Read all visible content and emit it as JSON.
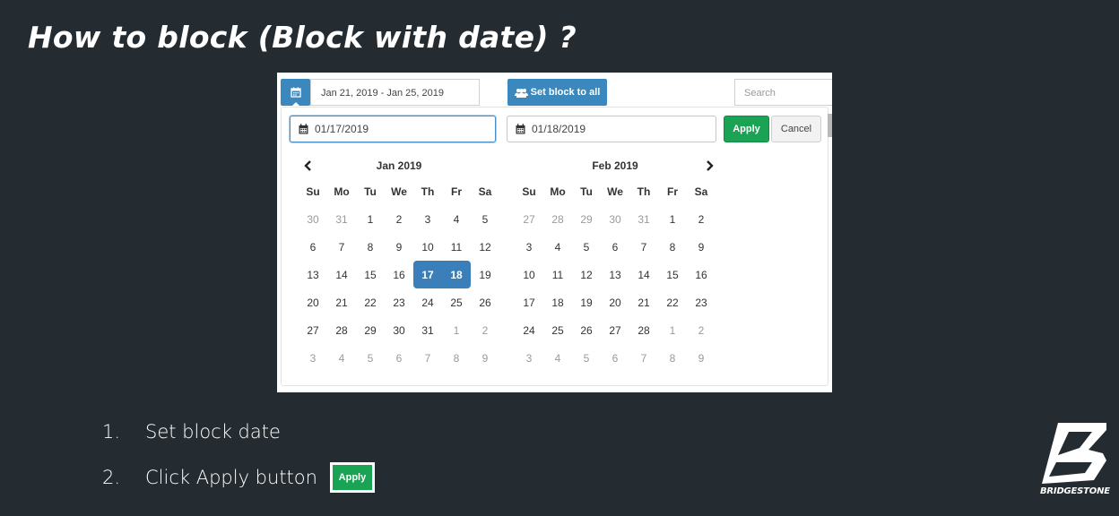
{
  "slide": {
    "title": "How to block (Block with date) ?"
  },
  "toolbar": {
    "range_value": "Jan 21, 2019 - Jan 25, 2019",
    "set_all_label": "Set block to all",
    "search_placeholder": "Search"
  },
  "picker": {
    "start_date": "01/17/2019",
    "end_date": "01/18/2019",
    "apply_label": "Apply",
    "cancel_label": "Cancel",
    "weekdays": [
      "Su",
      "Mo",
      "Tu",
      "We",
      "Th",
      "Fr",
      "Sa"
    ],
    "months": [
      {
        "name": "Jan 2019",
        "weeks": [
          [
            {
              "d": "30",
              "off": true
            },
            {
              "d": "31",
              "off": true
            },
            {
              "d": "1"
            },
            {
              "d": "2"
            },
            {
              "d": "3"
            },
            {
              "d": "4"
            },
            {
              "d": "5"
            }
          ],
          [
            {
              "d": "6"
            },
            {
              "d": "7"
            },
            {
              "d": "8"
            },
            {
              "d": "9"
            },
            {
              "d": "10"
            },
            {
              "d": "11"
            },
            {
              "d": "12"
            }
          ],
          [
            {
              "d": "13"
            },
            {
              "d": "14"
            },
            {
              "d": "15"
            },
            {
              "d": "16"
            },
            {
              "d": "17",
              "sel": "start"
            },
            {
              "d": "18",
              "sel": "end"
            },
            {
              "d": "19"
            }
          ],
          [
            {
              "d": "20"
            },
            {
              "d": "21"
            },
            {
              "d": "22"
            },
            {
              "d": "23"
            },
            {
              "d": "24"
            },
            {
              "d": "25"
            },
            {
              "d": "26"
            }
          ],
          [
            {
              "d": "27"
            },
            {
              "d": "28"
            },
            {
              "d": "29"
            },
            {
              "d": "30"
            },
            {
              "d": "31"
            },
            {
              "d": "1",
              "off": true
            },
            {
              "d": "2",
              "off": true
            }
          ],
          [
            {
              "d": "3",
              "off": true
            },
            {
              "d": "4",
              "off": true
            },
            {
              "d": "5",
              "off": true
            },
            {
              "d": "6",
              "off": true
            },
            {
              "d": "7",
              "off": true
            },
            {
              "d": "8",
              "off": true
            },
            {
              "d": "9",
              "off": true
            }
          ]
        ]
      },
      {
        "name": "Feb 2019",
        "weeks": [
          [
            {
              "d": "27",
              "off": true
            },
            {
              "d": "28",
              "off": true
            },
            {
              "d": "29",
              "off": true
            },
            {
              "d": "30",
              "off": true
            },
            {
              "d": "31",
              "off": true
            },
            {
              "d": "1"
            },
            {
              "d": "2"
            }
          ],
          [
            {
              "d": "3"
            },
            {
              "d": "4"
            },
            {
              "d": "5"
            },
            {
              "d": "6"
            },
            {
              "d": "7"
            },
            {
              "d": "8"
            },
            {
              "d": "9"
            }
          ],
          [
            {
              "d": "10"
            },
            {
              "d": "11"
            },
            {
              "d": "12"
            },
            {
              "d": "13"
            },
            {
              "d": "14"
            },
            {
              "d": "15"
            },
            {
              "d": "16"
            }
          ],
          [
            {
              "d": "17"
            },
            {
              "d": "18"
            },
            {
              "d": "19"
            },
            {
              "d": "20"
            },
            {
              "d": "21"
            },
            {
              "d": "22"
            },
            {
              "d": "23"
            }
          ],
          [
            {
              "d": "24"
            },
            {
              "d": "25"
            },
            {
              "d": "26"
            },
            {
              "d": "27"
            },
            {
              "d": "28"
            },
            {
              "d": "1",
              "off": true
            },
            {
              "d": "2",
              "off": true
            }
          ],
          [
            {
              "d": "3",
              "off": true
            },
            {
              "d": "4",
              "off": true
            },
            {
              "d": "5",
              "off": true
            },
            {
              "d": "6",
              "off": true
            },
            {
              "d": "7",
              "off": true
            },
            {
              "d": "8",
              "off": true
            },
            {
              "d": "9",
              "off": true
            }
          ]
        ]
      }
    ]
  },
  "steps": [
    {
      "num": "1.",
      "text": "Set block date"
    },
    {
      "num": "2.",
      "text": "Click Apply button",
      "badge": "Apply"
    }
  ],
  "logo": {
    "word": "BRIDGESTONE"
  },
  "icons": {
    "calendar": "calendar-icon",
    "users": "users-icon",
    "prev": "chevron-left-icon",
    "next": "chevron-right-icon",
    "logo": "bridgestone-b-logo"
  },
  "colors": {
    "background": "#252c31",
    "primary": "#3a88be",
    "success": "#1aa354",
    "selected": "#3a7fb9"
  }
}
